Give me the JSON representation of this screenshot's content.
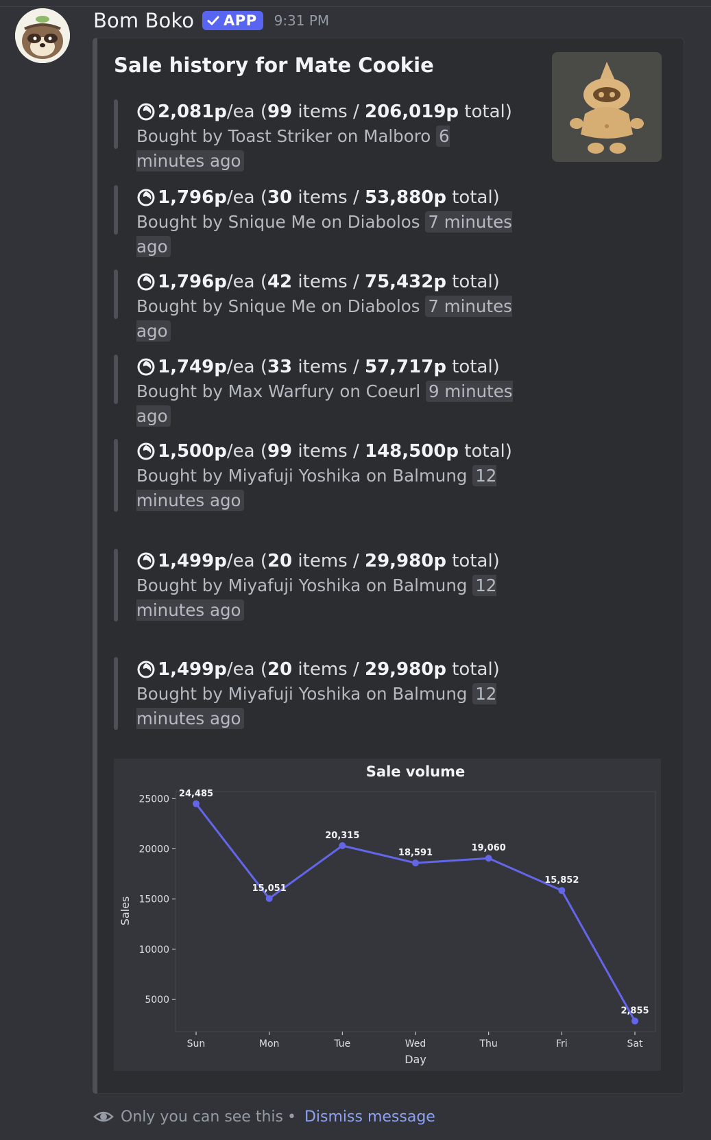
{
  "message": {
    "author": "Bom Boko",
    "badge": "APP",
    "time": "9:31 PM"
  },
  "embed": {
    "title": "Sale history for Mate Cookie",
    "sales": [
      {
        "price": "2,081p",
        "unit": "/ea (",
        "qty": "99",
        "items": " items / ",
        "total": "206,019p",
        "total_suffix": " total)",
        "by": "Bought by Toast Striker on Malboro",
        "ago": "6 minutes ago"
      },
      {
        "price": "1,796p",
        "unit": "/ea (",
        "qty": "30",
        "items": " items / ",
        "total": "53,880p",
        "total_suffix": " total)",
        "by": "Bought by Snique Me on Diabolos",
        "ago": "7 minutes ago"
      },
      {
        "price": "1,796p",
        "unit": "/ea (",
        "qty": "42",
        "items": " items / ",
        "total": "75,432p",
        "total_suffix": " total)",
        "by": "Bought by Snique Me on Diabolos",
        "ago": "7 minutes ago"
      },
      {
        "price": "1,749p",
        "unit": "/ea (",
        "qty": "33",
        "items": " items / ",
        "total": "57,717p",
        "total_suffix": " total)",
        "by": "Bought by Max Warfury on Coeurl",
        "ago": "9 minutes ago"
      },
      {
        "price": "1,500p",
        "unit": "/ea (",
        "qty": "99",
        "items": " items / ",
        "total": "148,500p",
        "total_suffix": " total)",
        "by": "Bought by Miyafuji Yoshika on Balmung",
        "ago": "12 minutes ago"
      },
      {
        "price": "1,499p",
        "unit": "/ea (",
        "qty": "20",
        "items": " items / ",
        "total": "29,980p",
        "total_suffix": " total)",
        "by": "Bought by Miyafuji Yoshika on Balmung",
        "ago": "12 minutes ago"
      },
      {
        "price": "1,499p",
        "unit": "/ea (",
        "qty": "20",
        "items": " items / ",
        "total": "29,980p",
        "total_suffix": " total)",
        "by": "Bought by Miyafuji Yoshika on Balmung",
        "ago": "12 minutes ago"
      }
    ]
  },
  "chart_data": {
    "type": "line",
    "title": "Sale volume",
    "xlabel": "Day",
    "ylabel": "Sales",
    "categories": [
      "Sun",
      "Mon",
      "Tue",
      "Wed",
      "Thu",
      "Fri",
      "Sat"
    ],
    "values": [
      24485,
      15051,
      20315,
      18591,
      19060,
      15852,
      2855
    ],
    "value_labels": [
      "24,485",
      "15,051",
      "20,315",
      "18,591",
      "19,060",
      "15,852",
      "2,855"
    ],
    "yticks": [
      5000,
      10000,
      15000,
      20000,
      25000
    ],
    "ylim": [
      1800,
      25700
    ],
    "grid": false,
    "color": "#6366e8"
  },
  "footer": {
    "notice": "Only you can see this",
    "separator": "•",
    "dismiss": "Dismiss message"
  },
  "colors": {
    "background": "#313338",
    "embed": "#2b2d31",
    "accent": "#5865f2",
    "link": "#8ea1f2"
  }
}
